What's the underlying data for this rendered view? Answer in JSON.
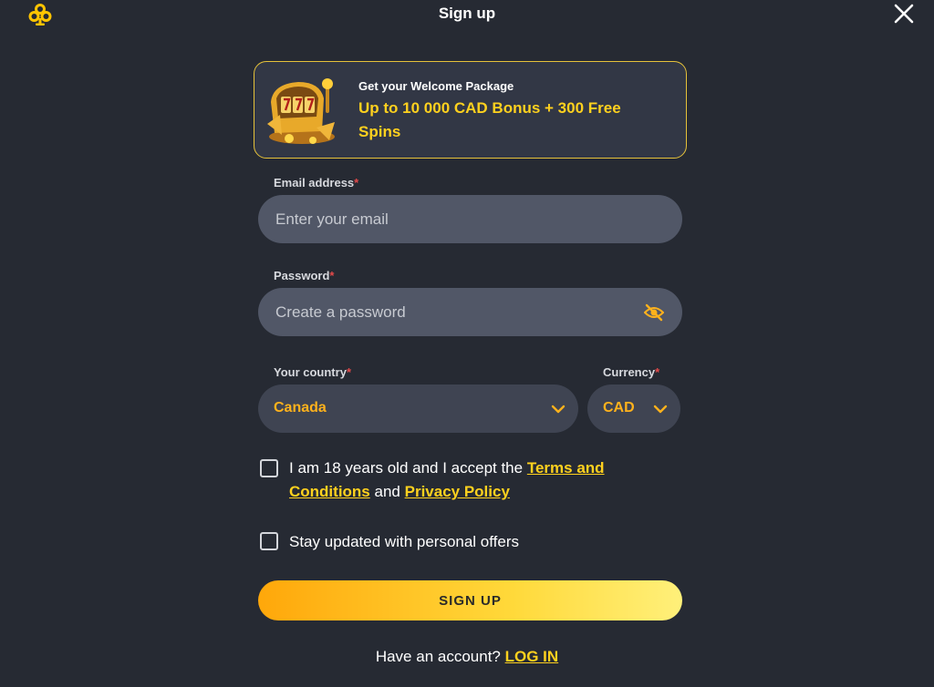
{
  "header": {
    "title": "Sign up",
    "logo_icon": "clover-icon",
    "close_icon": "close-icon"
  },
  "promo": {
    "kicker": "Get your Welcome Package",
    "offer": "Up to 10 000 CAD Bonus + 300 Free Spins",
    "art_icon": "slot-machine-777-icon"
  },
  "form": {
    "email": {
      "label": "Email address",
      "required_mark": "*",
      "placeholder": "Enter your email",
      "value": ""
    },
    "password": {
      "label": "Password",
      "required_mark": "*",
      "placeholder": "Create a password",
      "value": "",
      "toggle_icon": "eye-off-icon"
    },
    "country": {
      "label": "Your country",
      "required_mark": "*",
      "value": "Canada"
    },
    "currency": {
      "label": "Currency",
      "required_mark": "*",
      "value": "CAD"
    },
    "terms": {
      "text_before": "I am 18 years old and I accept the",
      "terms_link": "Terms and Conditions",
      "text_between": "and",
      "privacy_link": "Privacy Policy",
      "checked": false
    },
    "offers": {
      "text": "Stay updated with personal offers",
      "checked": false
    },
    "submit_label": "SIGN UP"
  },
  "footer": {
    "prompt": "Have an account?",
    "login_link": "LOG IN"
  },
  "colors": {
    "background": "#262a33",
    "accent": "#ffd11e",
    "accent_orange": "#ffb21c",
    "input_bg": "#515767",
    "select_bg": "#3f4452"
  }
}
